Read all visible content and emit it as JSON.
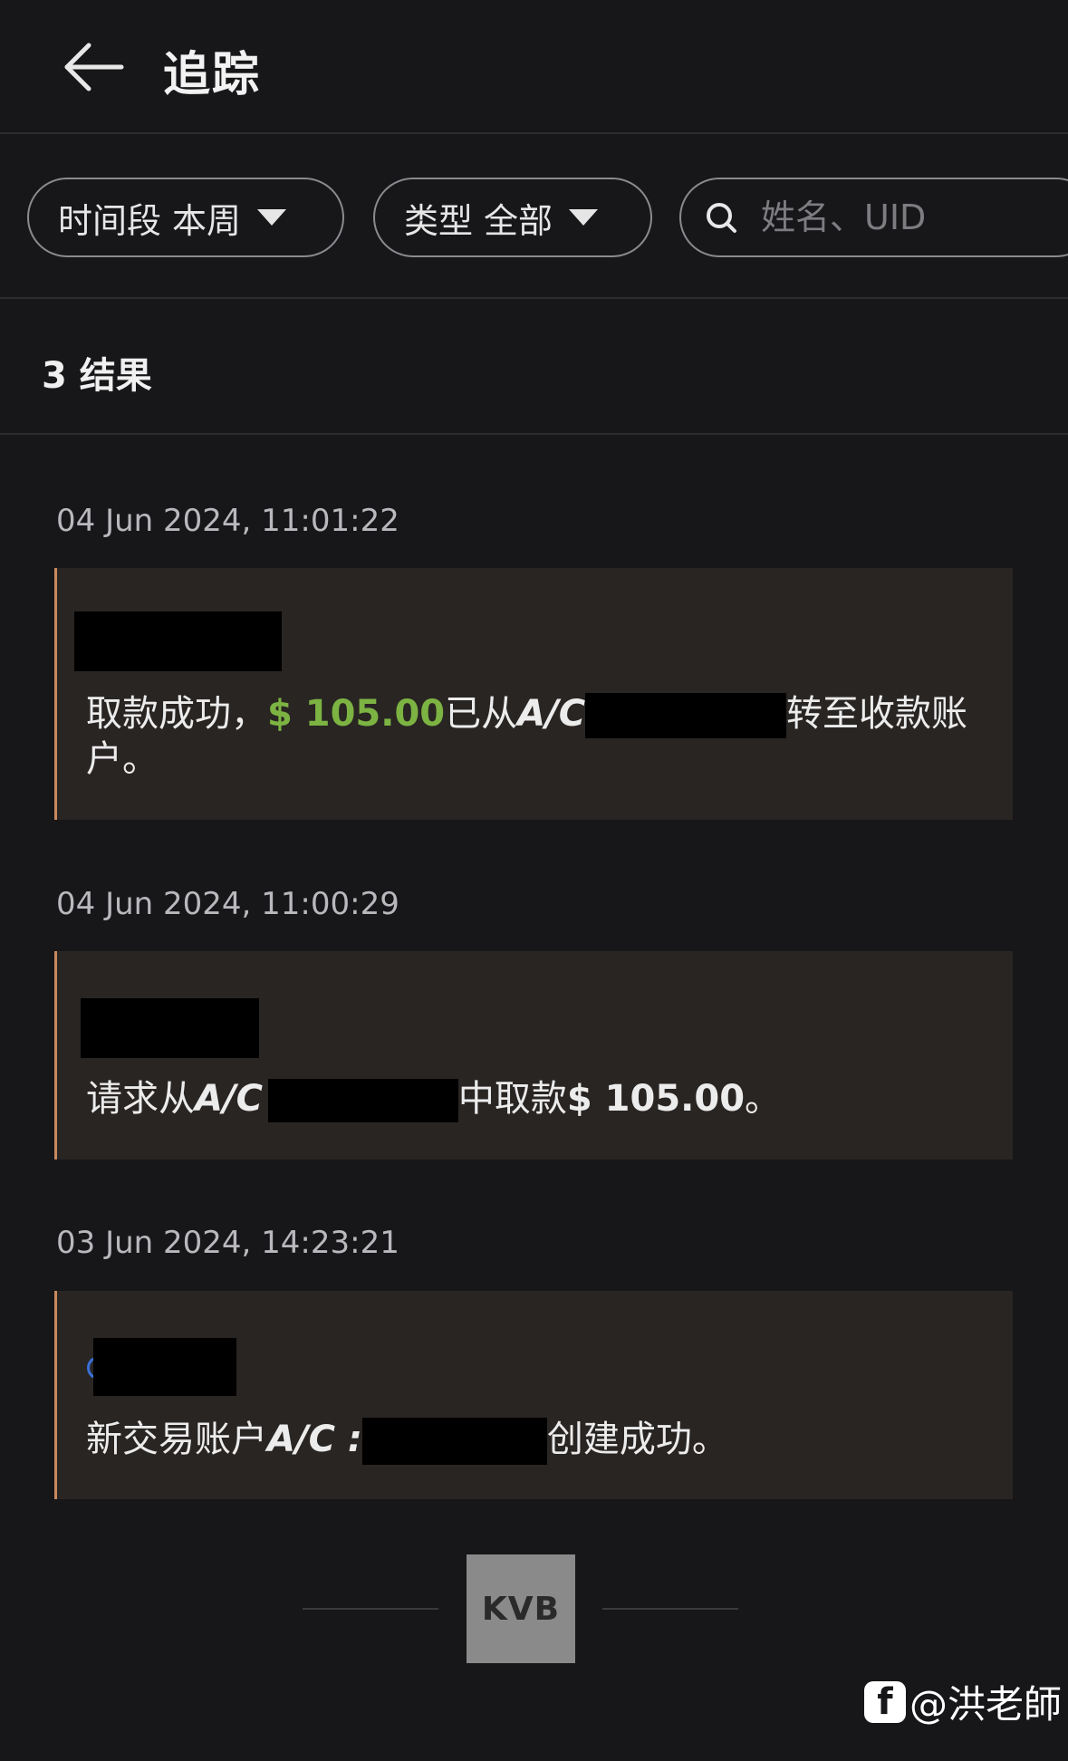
{
  "header": {
    "title": "追踪"
  },
  "filters": {
    "time": {
      "label": "时间段",
      "value": "本周"
    },
    "type": {
      "label": "类型",
      "value": "全部"
    },
    "search": {
      "placeholder": "姓名、UID"
    }
  },
  "results": {
    "count_text": "3 结果"
  },
  "entries": [
    {
      "timestamp": "04 Jun 2024, 11:01:22",
      "msg_prefix": "取款成功，",
      "amount": "$ 105.00",
      "msg_mid": "已从",
      "ac": "A/C",
      "msg_suffix": "转至收款账户。"
    },
    {
      "timestamp": "04 Jun 2024, 11:00:29",
      "msg_prefix": "请求从",
      "ac": "A/C",
      "msg_mid": "中取款",
      "amount": "$ 105.00",
      "msg_suffix": "。"
    },
    {
      "timestamp": "03 Jun 2024, 14:23:21",
      "msg_prefix": "新交易账户",
      "ac": "A/C :",
      "msg_suffix": "创建成功。"
    }
  ],
  "footer": {
    "logo_text": "KVB"
  },
  "watermark": {
    "fb_letter": "f",
    "text": "@洪老師"
  },
  "colors": {
    "accent_green": "#7cb342",
    "card_border": "#c98a5e",
    "background": "#17171a"
  }
}
